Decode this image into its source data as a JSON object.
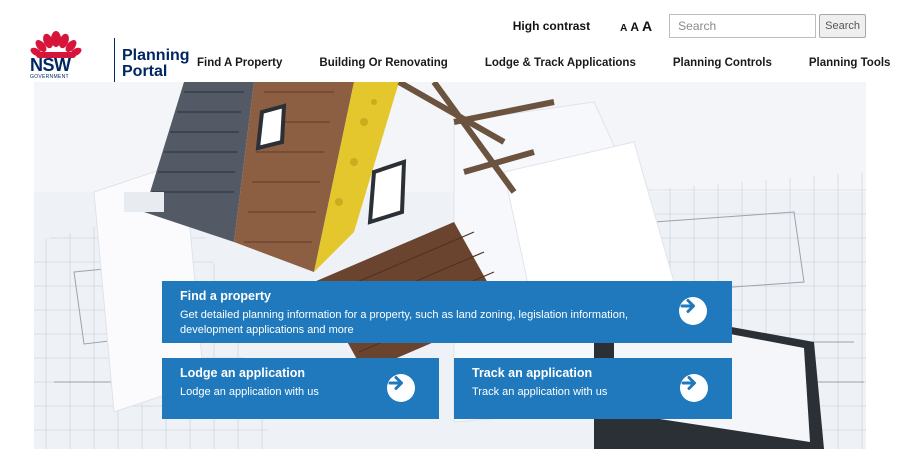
{
  "header": {
    "logo": {
      "nsw": "NSW",
      "government": "GOVERNMENT",
      "portal_line1": "Planning",
      "portal_line2": "Portal"
    },
    "utility": {
      "high_contrast": "High contrast",
      "text_sizes": [
        "A",
        "A",
        "A"
      ],
      "search_placeholder": "Search",
      "search_button": "Search"
    },
    "nav": [
      "Find A Property",
      "Building Or Renovating",
      "Lodge & Track Applications",
      "Planning Controls",
      "Planning Tools"
    ]
  },
  "cards": {
    "find": {
      "title": "Find a property",
      "description": "Get detailed planning information for a property, such as land zoning, legislation information, development applications and more"
    },
    "lodge": {
      "title": "Lodge an application",
      "description": "Lodge an application with us"
    },
    "track": {
      "title": "Track an application",
      "description": "Track an application with us"
    }
  },
  "colors": {
    "brand_navy": "#002664",
    "brand_red": "#d7153a",
    "card_blue": "#1f79bc"
  },
  "icons": {
    "card_arrow": "arrow-right-circle-icon",
    "logo": "waratah-icon"
  }
}
